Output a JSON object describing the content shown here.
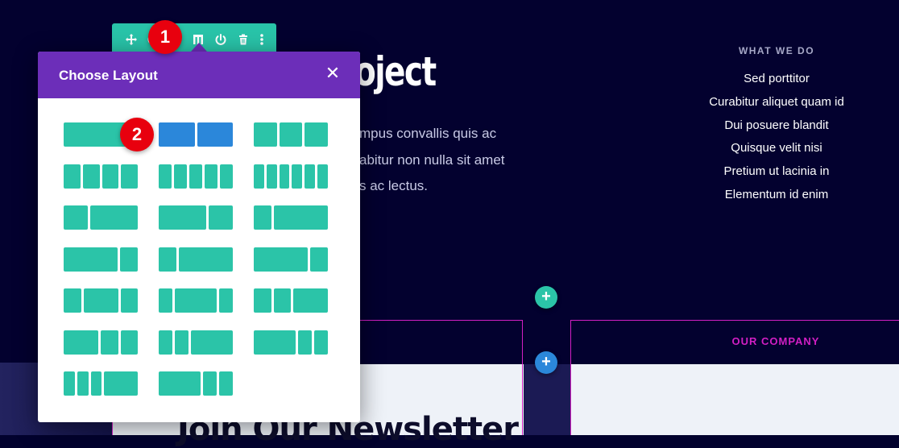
{
  "hero": {
    "title_fragment": "oject",
    "lines": [
      "mpus convallis quis ac",
      "abitur non nulla sit amet",
      "s ac lectus."
    ]
  },
  "what_we_do": {
    "title": "WHAT WE DO",
    "items": [
      "Sed porttitor",
      "Curabitur aliquet quam id",
      "Dui posuere blandit",
      "Quisque velit nisi",
      "Pretium ut lacinia in",
      "Elementum id enim"
    ]
  },
  "section": {
    "company_label": "OUR COMPANY",
    "newsletter_heading": "Join Our Newsletter"
  },
  "toolbar": {
    "icons": [
      "move-icon",
      "settings-icon",
      "columns-icon",
      "power-icon",
      "trash-icon",
      "more-icon"
    ]
  },
  "badges": {
    "step1": "1",
    "step2": "2"
  },
  "modal": {
    "title": "Choose Layout",
    "close": "✕",
    "layouts": [
      [
        [
          1
        ],
        [
          1,
          1
        ],
        [
          1,
          1,
          1
        ]
      ],
      [
        [
          1,
          1,
          1,
          1
        ],
        [
          1,
          1,
          1,
          1,
          1
        ],
        [
          1,
          1,
          1,
          1,
          1,
          1
        ]
      ],
      [
        [
          1,
          2
        ],
        [
          2,
          1
        ],
        [
          1,
          3
        ]
      ],
      [
        [
          3,
          1
        ],
        [
          1,
          3
        ],
        [
          3,
          1
        ]
      ],
      [
        [
          1,
          2,
          1
        ],
        [
          1,
          3,
          1
        ],
        [
          1,
          1,
          2
        ]
      ],
      [
        [
          2,
          1,
          1
        ],
        [
          1,
          1,
          3
        ],
        [
          3,
          1,
          1
        ]
      ],
      [
        [
          1,
          1,
          1,
          3
        ],
        [
          3,
          1,
          1
        ]
      ]
    ],
    "selected": [
      0,
      1
    ]
  },
  "colors": {
    "teal": "#2bc4a8",
    "blue": "#2b87da",
    "purple": "#6c2eb9",
    "badge_red": "#e8000e",
    "magenta": "#d21fc4",
    "navy": "#03012f"
  },
  "plus_buttons": {
    "label": "+"
  }
}
